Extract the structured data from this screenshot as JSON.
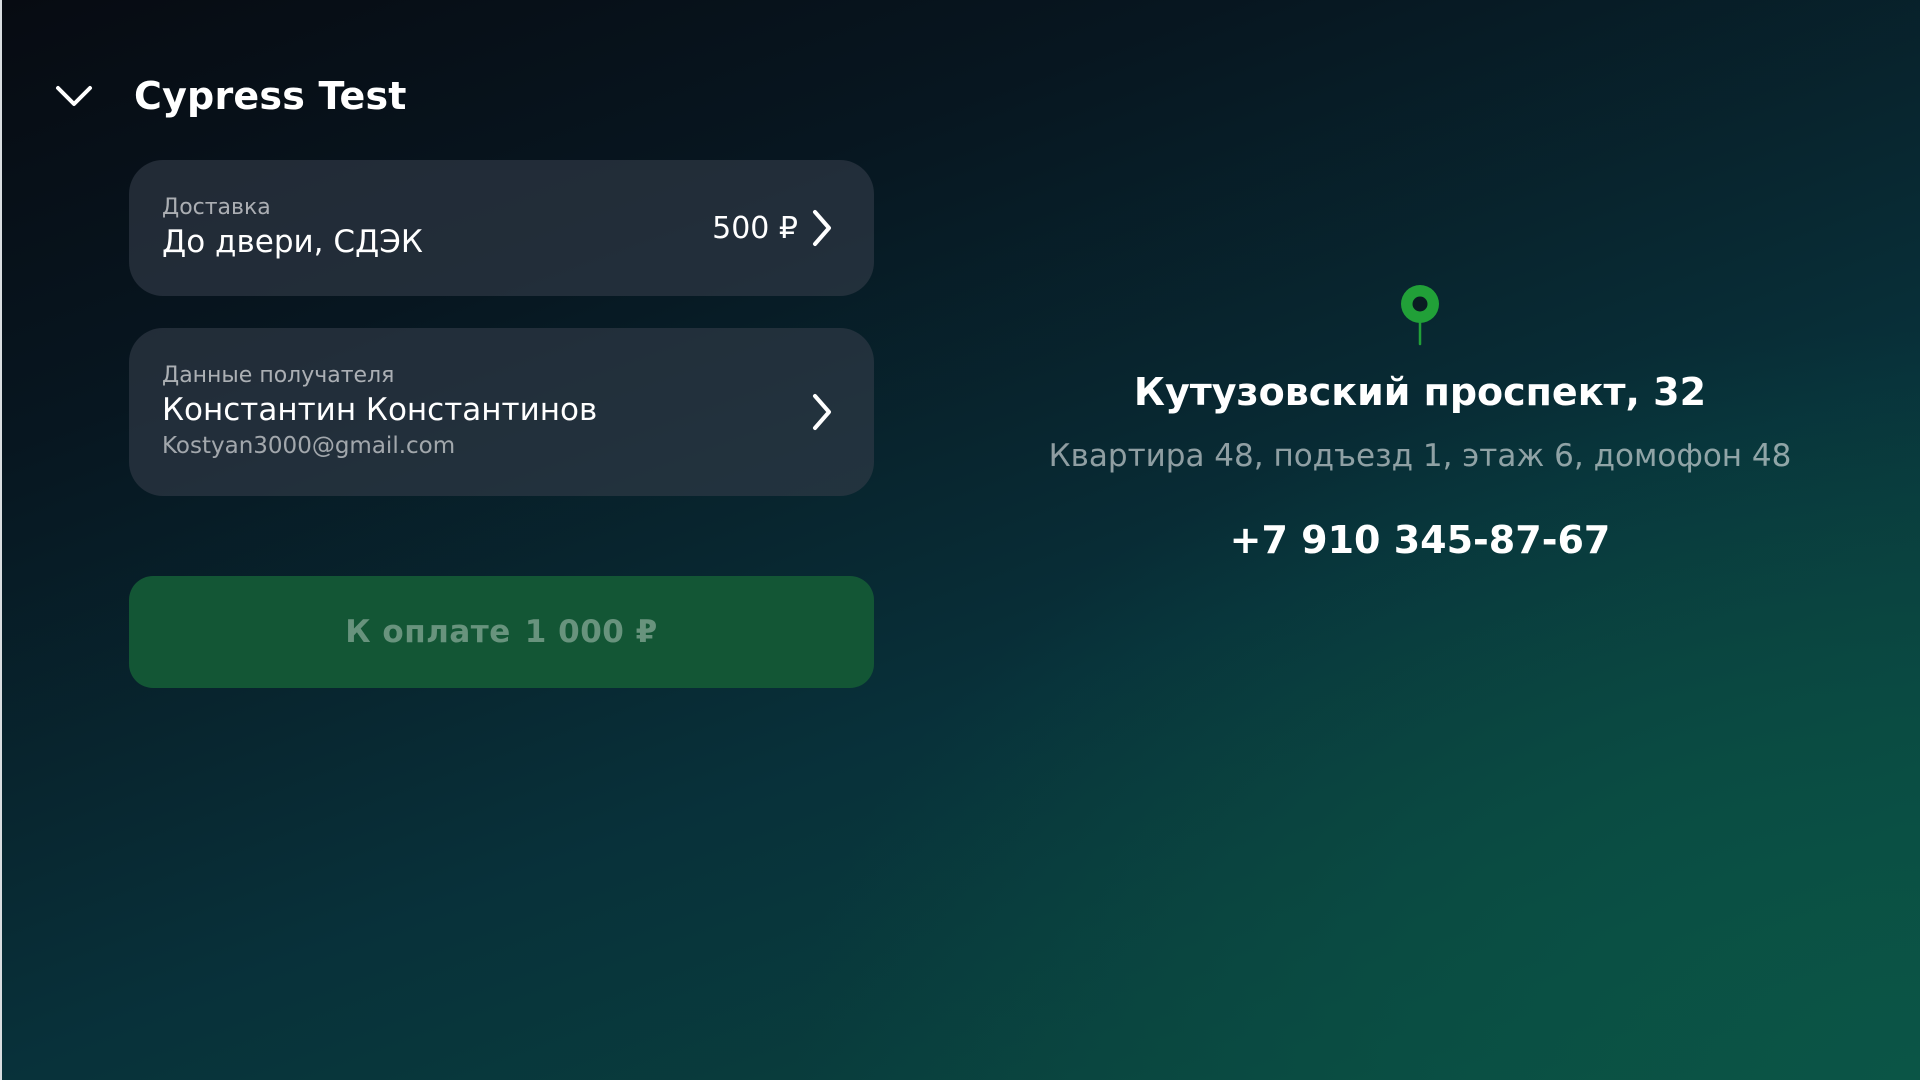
{
  "header": {
    "title": "Cypress Test",
    "back_icon": "chevron-down-icon"
  },
  "delivery": {
    "caption": "Доставка",
    "value": "До двери, СДЭК",
    "price": "500 ₽",
    "icon": "chevron-right-icon"
  },
  "recipient": {
    "caption": "Данные получателя",
    "name": "Константин Константинов",
    "email": "Kostyan3000@gmail.com",
    "icon": "chevron-right-icon"
  },
  "payment": {
    "label": "К оплате",
    "amount": "1 000 ₽"
  },
  "address": {
    "icon": "map-pin-icon",
    "title": "Кутузовский проспект, 32",
    "details": "Квартира 48, подъезд 1, этаж 6, домофон 48",
    "phone": "+7 910 345-87-67"
  },
  "colors": {
    "accent_green": "#21A038",
    "pay_button": "#135635"
  }
}
